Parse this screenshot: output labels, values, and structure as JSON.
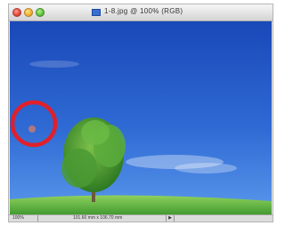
{
  "window": {
    "title": "1-8.jpg @ 100% (RGB)",
    "traffic_lights": [
      "close",
      "minimize",
      "zoom"
    ]
  },
  "canvas": {
    "image": "landscape photo: blue sky, green hill, single tree",
    "highlight": "red circle marking a spot in the sky"
  },
  "status_bar": {
    "zoom": "100%",
    "doc_info": "101.60 mm x 106.70 mm",
    "arrow": "▶"
  },
  "colors": {
    "sky_top": "#1d4fbf",
    "sky_bottom": "#4b88e6",
    "grass": "#5fb342",
    "tree": "#3f8f2c",
    "highlight_ring": "#e0202a"
  }
}
